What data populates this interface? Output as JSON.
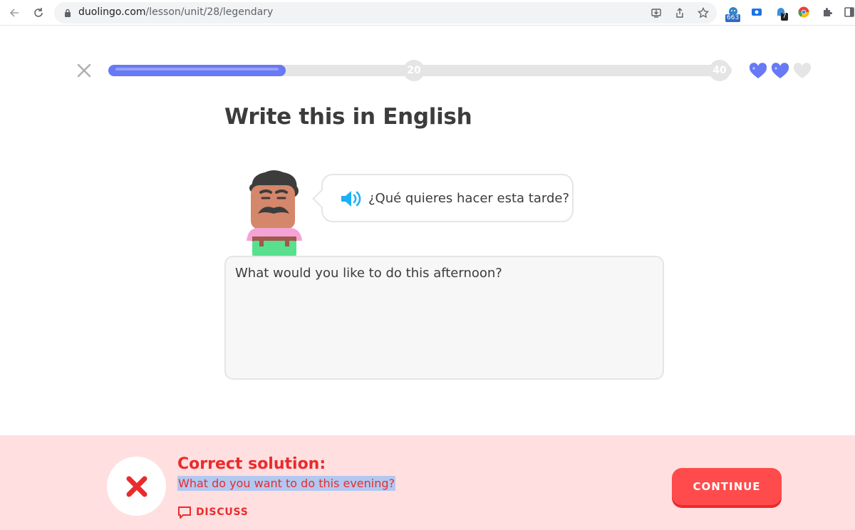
{
  "browser": {
    "url_host": "duolingo.com",
    "url_path": "/lesson/unit/28/legendary",
    "ext_badge_1": "663",
    "ext_badge_2": "7"
  },
  "lesson": {
    "progress_fraction": 0.285,
    "milestones": [
      "20",
      "40"
    ],
    "hearts_total": 3,
    "hearts_filled": 2,
    "title": "Write this in English",
    "prompt": "¿Qué quieres hacer esta tarde?",
    "answer": "What would you like to do this afternoon?"
  },
  "feedback": {
    "title": "Correct solution:",
    "solution": "What do you want to do this evening?",
    "discuss_label": "DISCUSS",
    "continue_label": "CONTINUE"
  },
  "colors": {
    "progress": "#6779f5",
    "heart": "#6779f5",
    "error": "#ea2b2b",
    "footer_bg": "#ffdfe0",
    "continue": "#ff4b4b"
  }
}
